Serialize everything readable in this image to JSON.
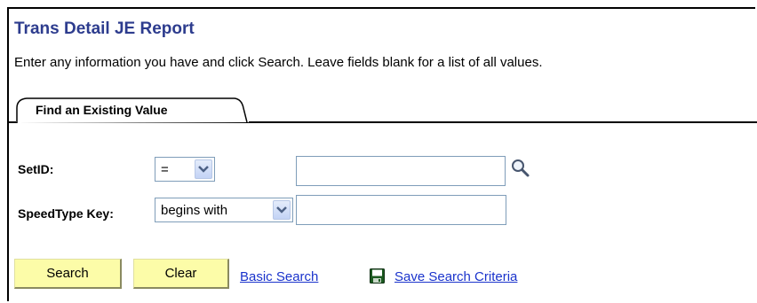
{
  "page": {
    "title": "Trans Detail JE Report",
    "instructions": "Enter any information you have and click Search. Leave fields blank for a list of all values."
  },
  "tabs": [
    {
      "label": "Find an Existing Value",
      "active": true
    }
  ],
  "fields": {
    "setid": {
      "label": "SetID:",
      "operator": "=",
      "value": ""
    },
    "speedtype": {
      "label": "SpeedType Key:",
      "operator": "begins with",
      "value": ""
    }
  },
  "buttons": {
    "search": "Search",
    "clear": "Clear"
  },
  "links": {
    "basic_search": "Basic Search",
    "save_search_criteria": "Save Search Criteria"
  },
  "icons": {
    "lookup": "magnifier-icon",
    "save": "floppy-disk-icon",
    "dropdown": "chevron-down-icon"
  },
  "colors": {
    "title": "#2d3c8e",
    "button_bg": "#fcfca8",
    "link": "#1a33cc",
    "input_border": "#7f9db9"
  }
}
